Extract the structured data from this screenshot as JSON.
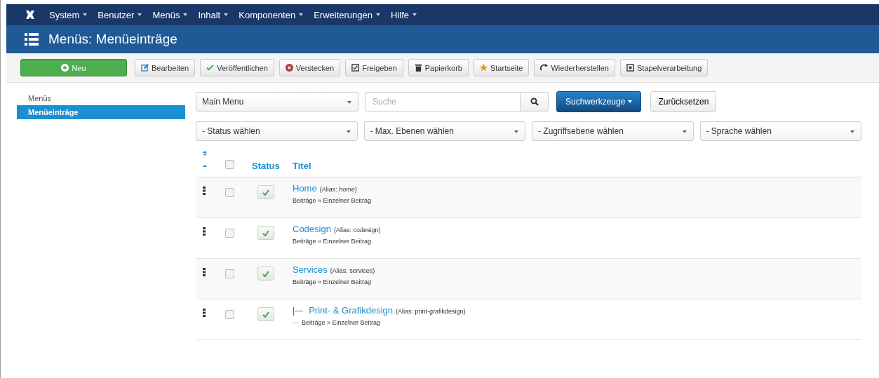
{
  "nav": {
    "menus": [
      "System",
      "Benutzer",
      "Menüs",
      "Inhalt",
      "Komponenten",
      "Erweiterungen",
      "Hilfe"
    ]
  },
  "header": {
    "title": "Menüs: Menüeinträge"
  },
  "toolbar": [
    {
      "label": "Neu",
      "kind": "new"
    },
    {
      "label": "Bearbeiten",
      "kind": "edit"
    },
    {
      "label": "Veröffentlichen",
      "kind": "publish"
    },
    {
      "label": "Verstecken",
      "kind": "hide"
    },
    {
      "label": "Freigeben",
      "kind": "checkin"
    },
    {
      "label": "Papierkorb",
      "kind": "trash"
    },
    {
      "label": "Startseite",
      "kind": "home"
    },
    {
      "label": "Wiederherstellen",
      "kind": "rebuild"
    },
    {
      "label": "Stapelverarbeitung",
      "kind": "batch"
    }
  ],
  "sidebar": {
    "items": [
      {
        "label": "Menüs",
        "selected": false
      },
      {
        "label": "Menüeinträge",
        "selected": true
      }
    ]
  },
  "filters": {
    "menu": "Main Menu",
    "search": {
      "placeholder": "Suche"
    },
    "search_tools": "Suchwerkzeuge",
    "reset": "Zurücksetzen",
    "selects": [
      "- Status wählen",
      "- Max. Ebenen wählen",
      "- Zugriffsebene wählen",
      "- Sprache wählen"
    ]
  },
  "table": {
    "all_checked": false,
    "columns": [
      "Status",
      "Titel"
    ],
    "rows": [
      {
        "title": "Home",
        "alias": "(Alias: home)",
        "type": "Beiträge » Einzelner Beitrag",
        "published": true,
        "checked": false
      },
      {
        "title": "Codesign",
        "alias": "(Alias: codesign)",
        "type": "Beiträge » Einzelner Beitrag",
        "published": true,
        "checked": false
      },
      {
        "title": "Services",
        "alias": "(Alias: services)",
        "type": "Beiträge » Einzelner Beitrag",
        "published": true,
        "checked": false,
        "children": [
          {
            "prefix": "|—",
            "type_prefix": "—",
            "title": "Print- & Grafikdesign",
            "alias": "(Alias: print-grafikdesign)",
            "type": "Beiträge » Einzelner Beitrag",
            "published": true,
            "checked": false
          }
        ]
      }
    ]
  }
}
